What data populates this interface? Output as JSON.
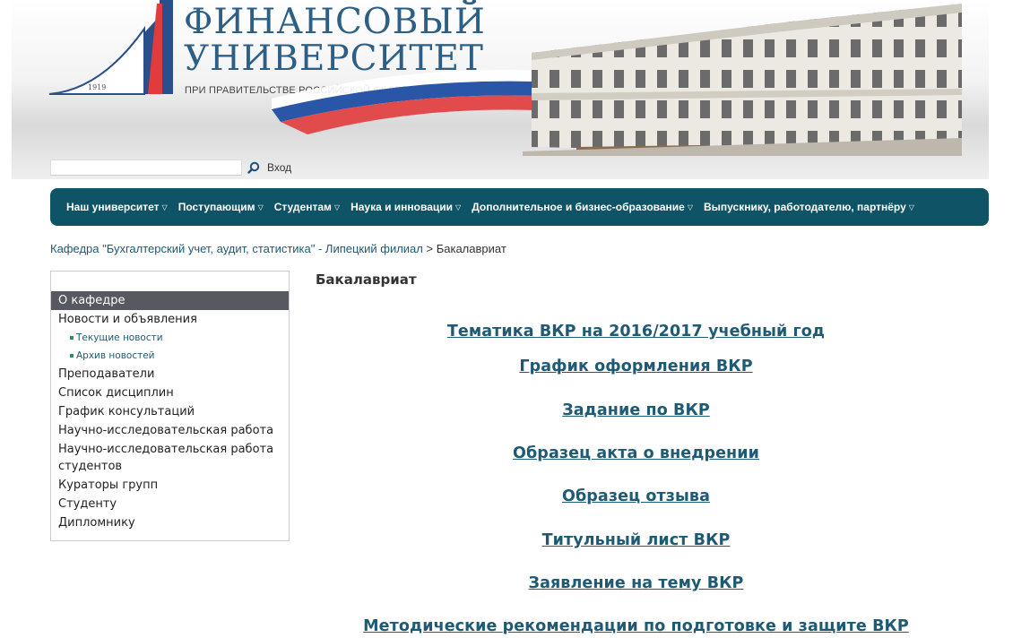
{
  "header": {
    "logo_line1": "ФИНАНСОВЫЙ",
    "logo_line2": "УНИВЕРСИТЕТ",
    "logo_subtitle": "ПРИ ПРАВИТЕЛЬСТВЕ РОССИЙСКОЙ ФЕДЕРАЦИИ",
    "logo_year": "1919"
  },
  "search": {
    "value": "",
    "login_label": "Вход"
  },
  "nav": {
    "items": [
      "Наш университет",
      "Поступающим",
      "Студентам",
      "Наука и инновации",
      "Дополнительное и бизнес-образование",
      "Выпускнику, работодателю, партнёру"
    ]
  },
  "breadcrumb": {
    "parent": "Кафедра \"Бухгалтерский учет, аудит, статистика\" - Липецкий филиал",
    "separator": " > ",
    "current": "Бакалавриат"
  },
  "sidebar": {
    "items": [
      {
        "label": "О кафедре"
      },
      {
        "label": "Новости и объявления"
      },
      {
        "label": "Текущие новости"
      },
      {
        "label": "Архив новостей"
      },
      {
        "label": "Преподаватели"
      },
      {
        "label": "Список дисциплин"
      },
      {
        "label": "График консультаций"
      },
      {
        "label": "Научно-исследовательская работа"
      },
      {
        "label": "Научно-исследовательская работа студентов"
      },
      {
        "label": "Кураторы групп"
      },
      {
        "label": "Студенту"
      },
      {
        "label": "Дипломнику"
      }
    ]
  },
  "main": {
    "title": "Бакалавриат",
    "links": [
      "Тематика ВКР на 2016/2017 учебный год",
      "График оформления ВКР",
      "Задание по ВКР",
      "Образец акта о внедрении",
      "Образец отзыва",
      "Титульный лист ВКР",
      "Заявление на тему ВКР",
      "Методические рекомендации по подготовке и защите ВКР"
    ]
  },
  "colors": {
    "nav_bg": "#0f5466",
    "link": "#1e5a73",
    "logo_blue": "#2d5f86",
    "sidebar_active": "#575860"
  }
}
